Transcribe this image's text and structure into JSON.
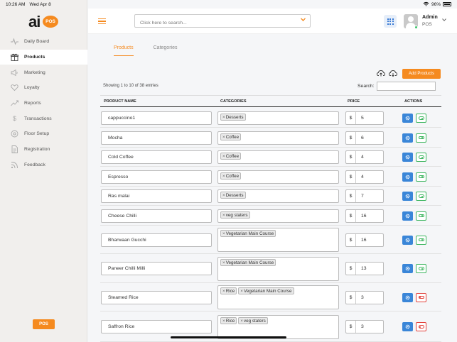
{
  "status_bar": {
    "time": "10:26 AM",
    "date": "Wed Apr 8",
    "battery": "96%"
  },
  "logo": {
    "text": "ai",
    "badge": "POS"
  },
  "sidebar": {
    "items": [
      {
        "label": "Daily Board",
        "icon": "pulse-icon",
        "active": false
      },
      {
        "label": "Products",
        "icon": "gift-icon",
        "active": true
      },
      {
        "label": "Marketing",
        "icon": "megaphone-icon",
        "active": false
      },
      {
        "label": "Loyalty",
        "icon": "heart-icon",
        "active": false
      },
      {
        "label": "Reports",
        "icon": "trend-icon",
        "active": false
      },
      {
        "label": "Transactions",
        "icon": "dollar-icon",
        "active": false
      },
      {
        "label": "Floor Setup",
        "icon": "target-icon",
        "active": false
      },
      {
        "label": "Registration",
        "icon": "document-icon",
        "active": false
      },
      {
        "label": "Feedback",
        "icon": "rss-icon",
        "active": false
      }
    ],
    "pos_button": "POS"
  },
  "header": {
    "search_placeholder": "Click here to search...",
    "user_name": "Admin",
    "user_role": "POS"
  },
  "tabs": [
    {
      "label": "Products",
      "active": true
    },
    {
      "label": "Categories",
      "active": false
    }
  ],
  "toolbar": {
    "add_label": "Add Products"
  },
  "table": {
    "showing": "Showing 1 to 10 of 38 entries",
    "search_label": "Search:",
    "columns": [
      "PRODUCT NAME",
      "CATEGORIES",
      "PRICE",
      "ACTIONS"
    ],
    "currency": "$",
    "rows": [
      {
        "name": "cappuccino1",
        "categories": [
          "Desserts"
        ],
        "price": "5",
        "active": true
      },
      {
        "name": "Mocha",
        "categories": [
          "Coffee"
        ],
        "price": "6",
        "active": true
      },
      {
        "name": "Cold Coffee",
        "categories": [
          "Coffee"
        ],
        "price": "4",
        "active": true
      },
      {
        "name": "Espresso",
        "categories": [
          "Coffee"
        ],
        "price": "4",
        "active": true
      },
      {
        "name": "Ras malai",
        "categories": [
          "Desserts"
        ],
        "price": "7",
        "active": true
      },
      {
        "name": "Cheese Chilli",
        "categories": [
          "veg staters"
        ],
        "price": "16",
        "active": true
      },
      {
        "name": "Bharwaan Gucchi",
        "categories": [
          "Vegetarian Main Course"
        ],
        "price": "16",
        "active": true
      },
      {
        "name": "Paneer Chilli Milli",
        "categories": [
          "Vegetarian Main Course"
        ],
        "price": "13",
        "active": true
      },
      {
        "name": "Steamed Rice",
        "categories": [
          "Rice",
          "Vegetarian Main Course"
        ],
        "price": "3",
        "active": false
      },
      {
        "name": "Saffron Rice",
        "categories": [
          "Rice",
          "veg staters"
        ],
        "price": "3",
        "active": false
      }
    ]
  },
  "colors": {
    "accent": "#f58a1f",
    "edit": "#3a86d8",
    "active_toggle": "#3cb55e",
    "inactive_toggle": "#e2413b"
  }
}
